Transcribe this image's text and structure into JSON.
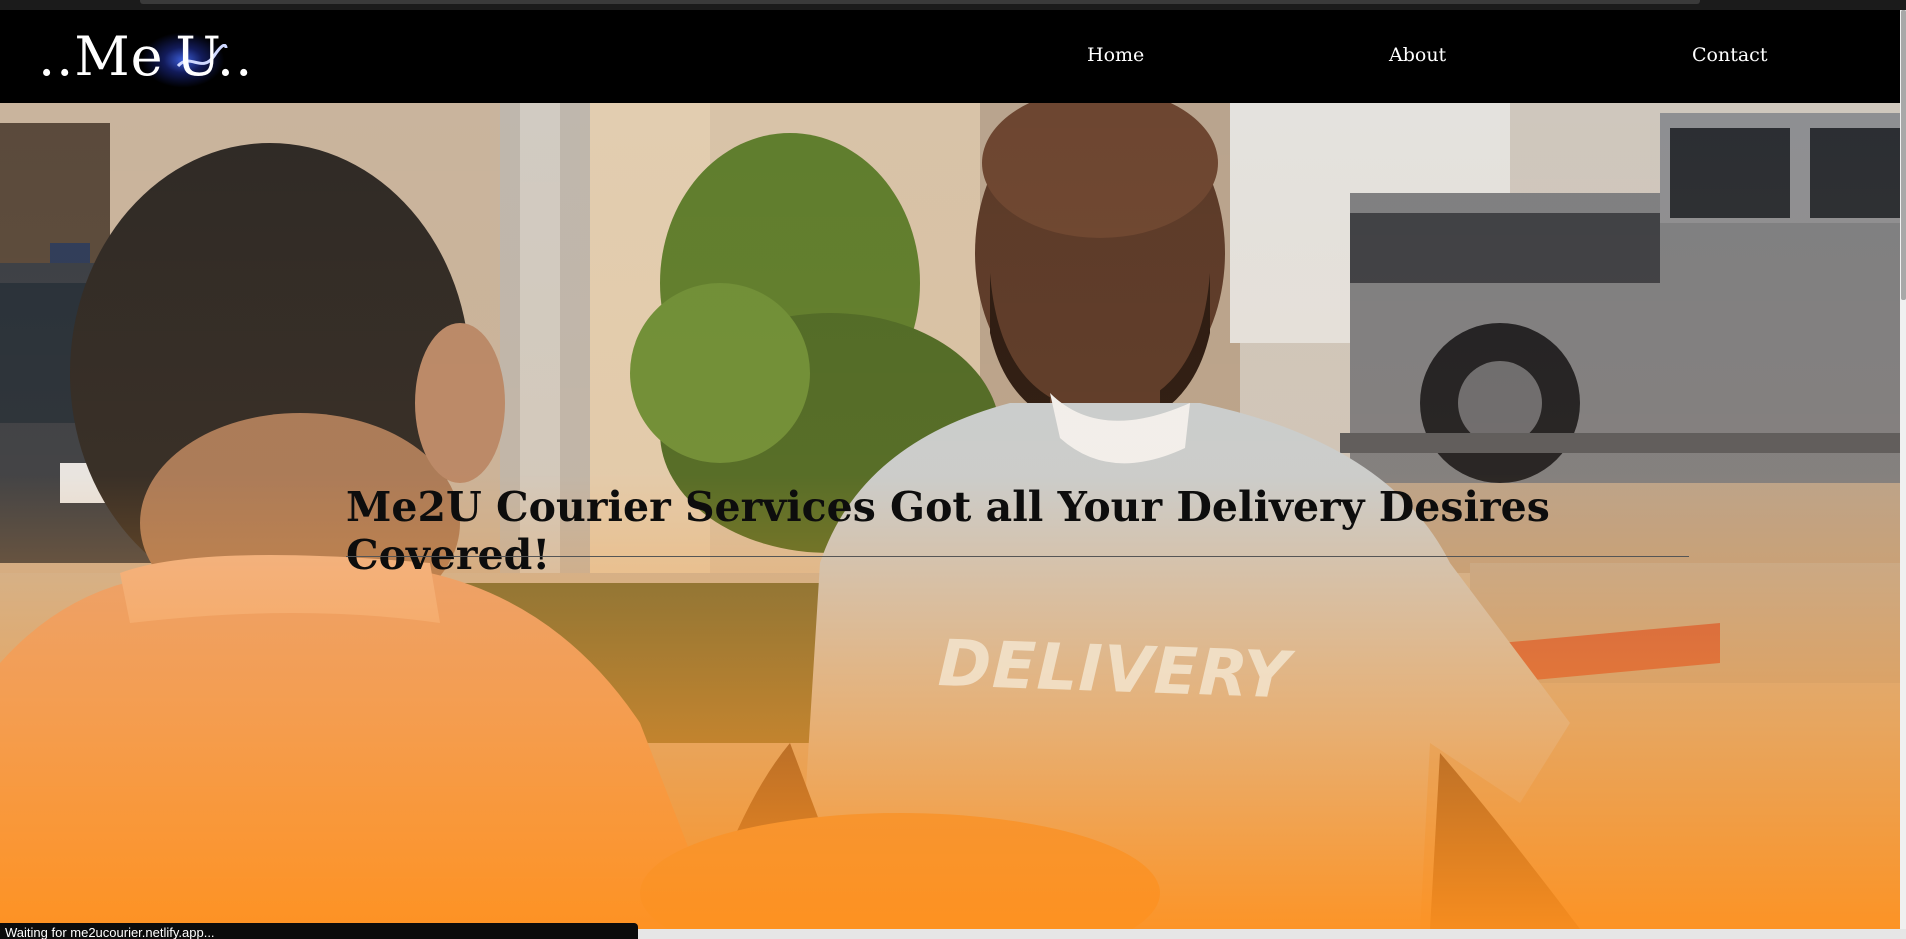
{
  "logo": {
    "text": "..Me U.."
  },
  "nav": {
    "home": "Home",
    "about": "About",
    "contact": "Contact"
  },
  "hero": {
    "headline": "Me2U Courier Services Got all Your Delivery Desires Covered!",
    "shirt_text": "DELIVERY"
  },
  "status_bar": {
    "text": "Waiting for me2ucourier.netlify.app..."
  },
  "colors": {
    "navbar_bg": "#000000",
    "nav_text": "#ffffff",
    "hero_overlay": "#ff9320",
    "headline_text": "#0d0d0d"
  },
  "icons": [
    "logo-swoosh-icon"
  ]
}
